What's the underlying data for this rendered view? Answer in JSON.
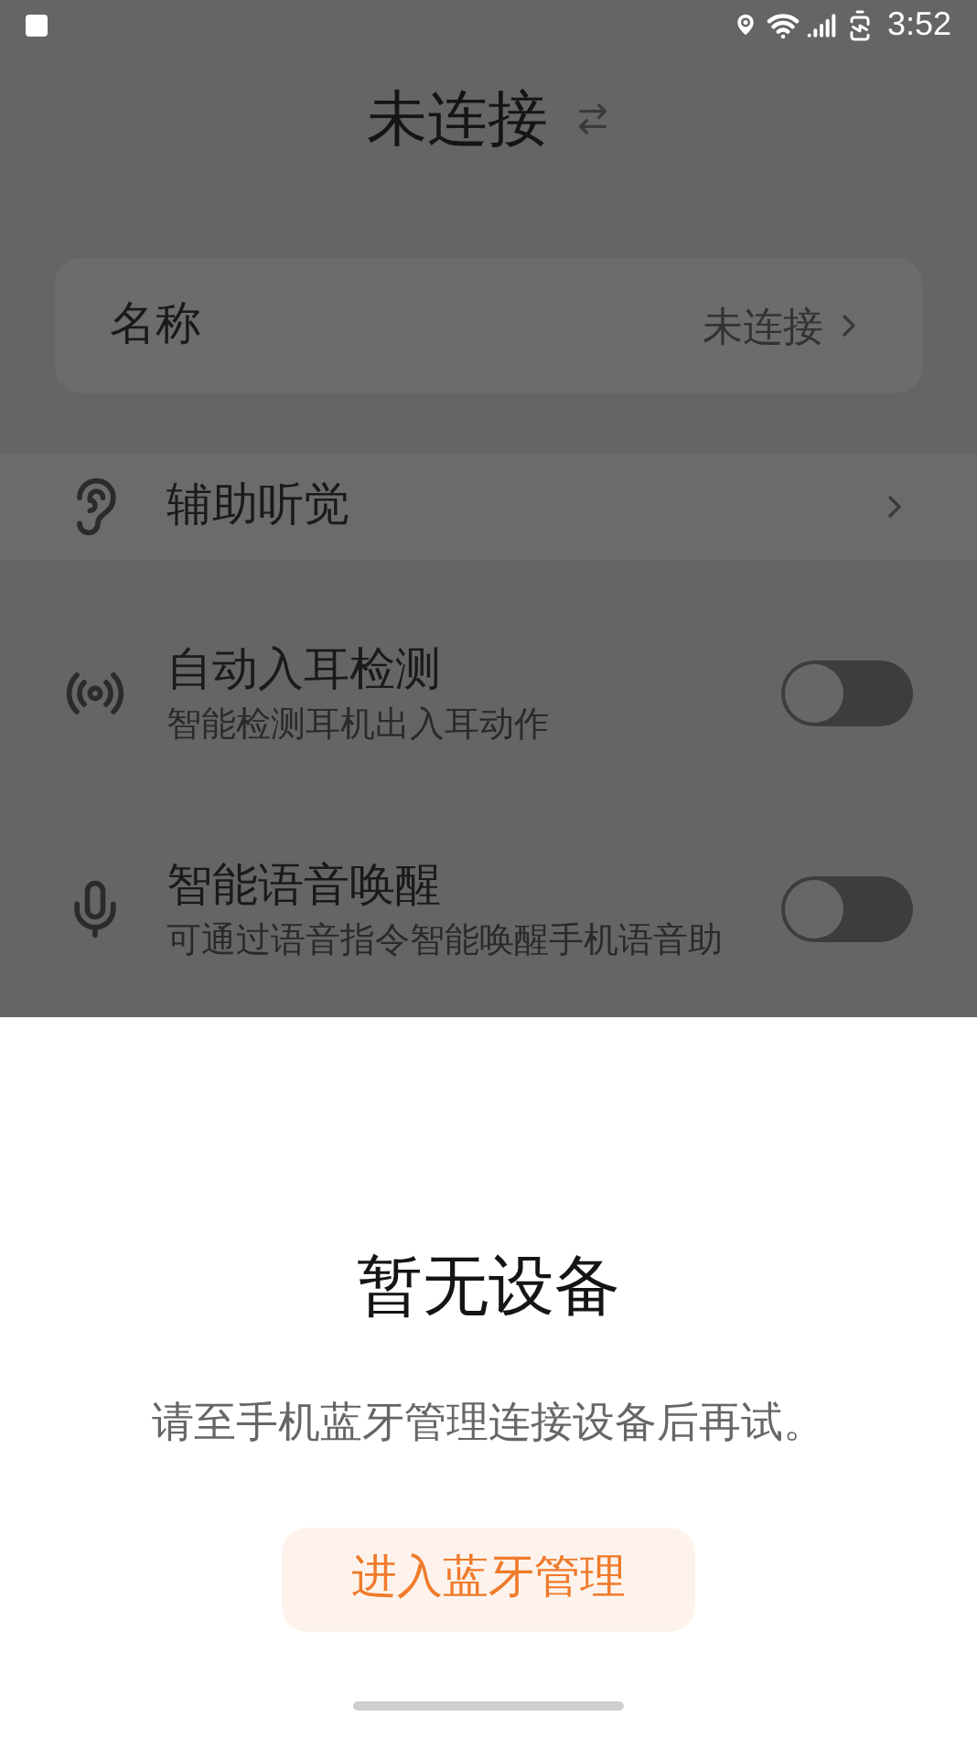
{
  "status_bar": {
    "time": "3:52"
  },
  "header": {
    "title": "未连接"
  },
  "name_card": {
    "label": "名称",
    "value": "未连接"
  },
  "settings": [
    {
      "kind": "link",
      "title": "辅助听觉"
    },
    {
      "kind": "toggle",
      "title": "自动入耳检测",
      "description": "智能检测耳机出入耳动作",
      "on": false
    },
    {
      "kind": "toggle",
      "title": "智能语音唤醒",
      "description": "可通过语音指令智能唤醒手机语音助",
      "on": false
    }
  ],
  "sheet": {
    "title": "暂无设备",
    "message": "请至手机蓝牙管理连接设备后再试。",
    "button": "进入蓝牙管理"
  }
}
